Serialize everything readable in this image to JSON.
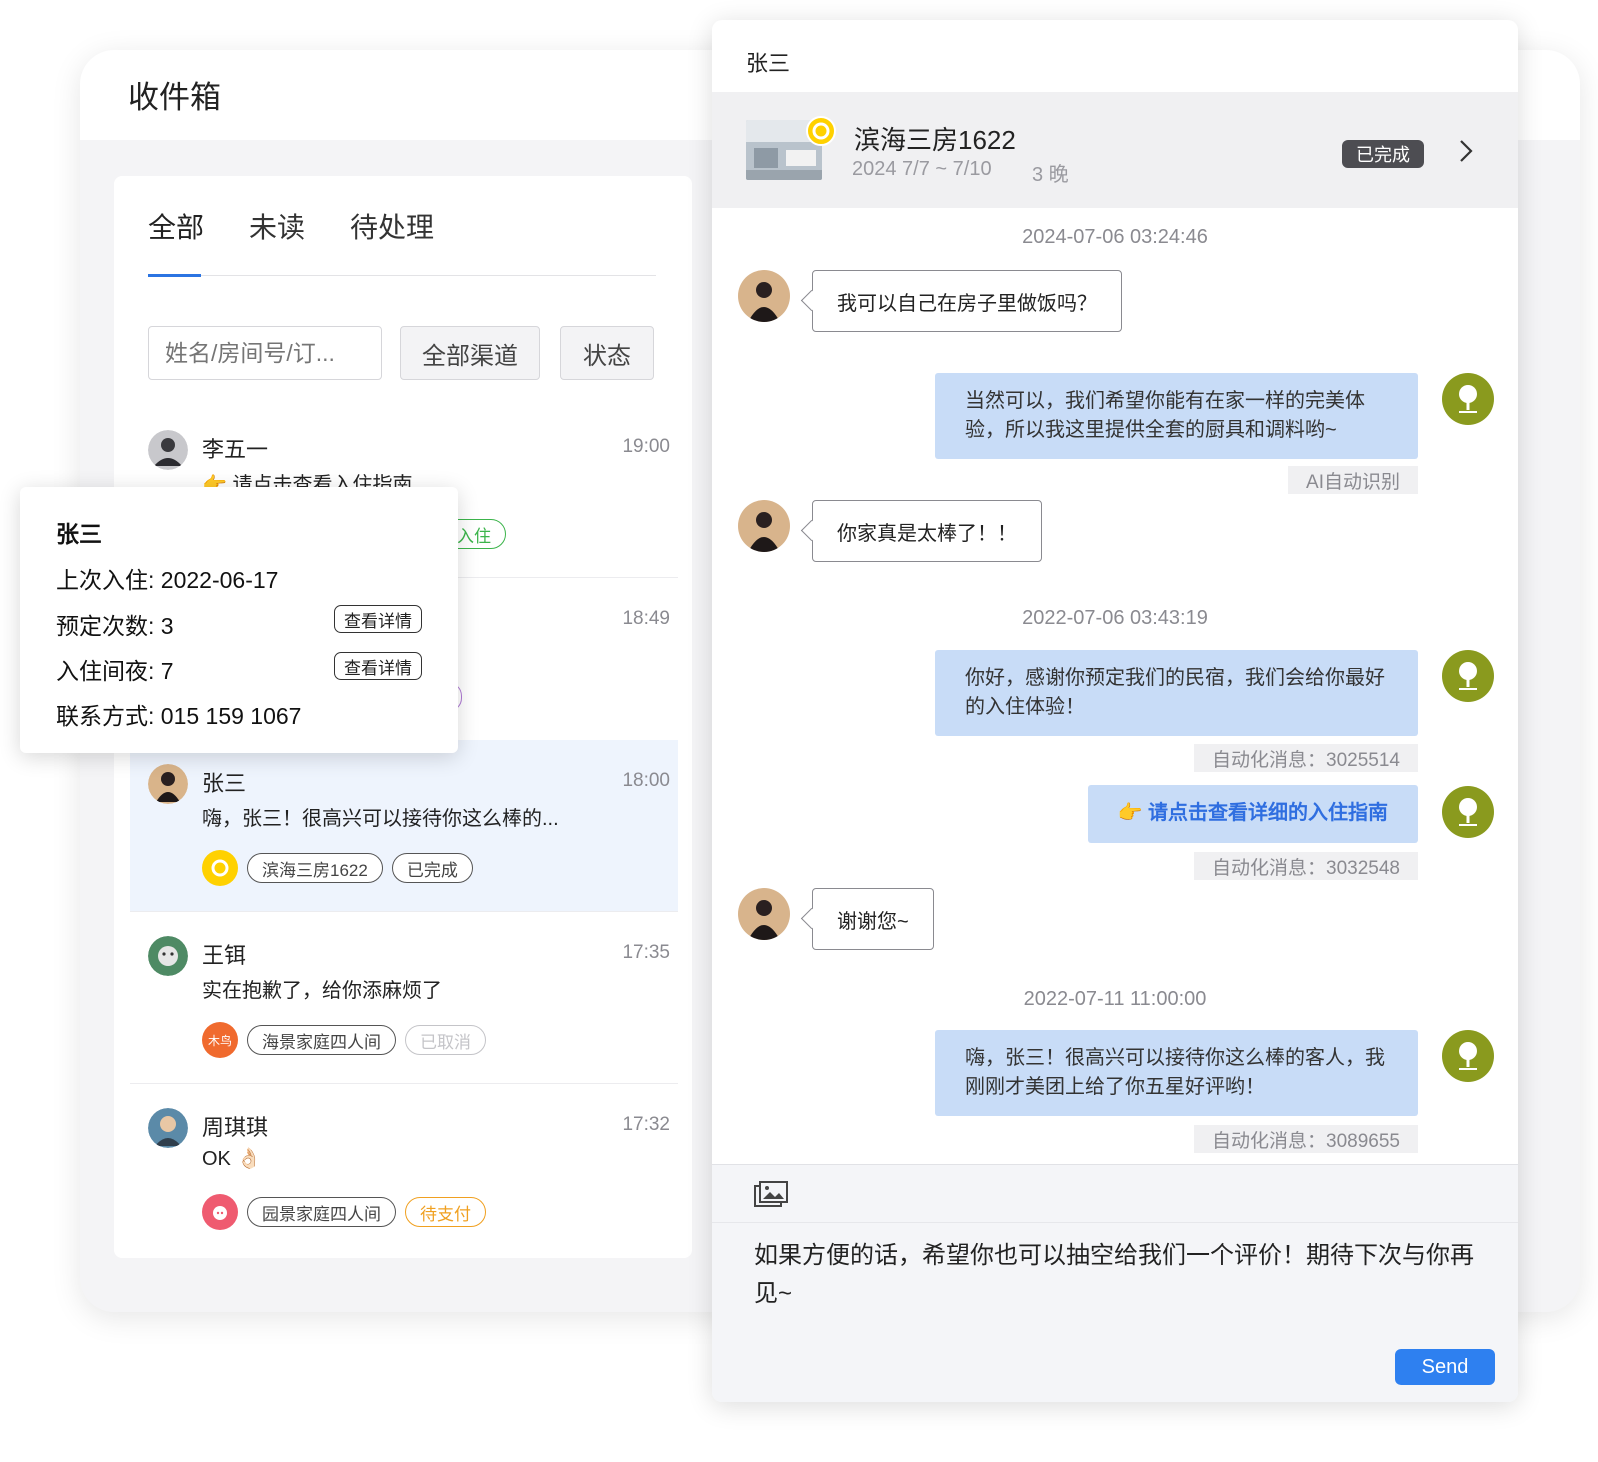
{
  "inbox": {
    "title": "收件箱",
    "tabs": [
      {
        "label": "全部",
        "active": true
      },
      {
        "label": "未读",
        "active": false
      },
      {
        "label": "待处理",
        "active": false
      }
    ],
    "search": {
      "placeholder": "姓名/房间号/订..."
    },
    "filters": {
      "channel": "全部渠道",
      "status": "状态"
    },
    "conversations": [
      {
        "name": "李五一",
        "time": "19:00",
        "preview": "👉 请点击查看入住指南",
        "tags": [
          "入住"
        ]
      },
      {
        "name": "",
        "time": "18:49",
        "preview": "",
        "tags": []
      },
      {
        "name": "张三",
        "time": "18:00",
        "preview": "嗨，张三！很高兴可以接待你这么棒的...",
        "tags": [
          "滨海三房1622",
          "已完成"
        ],
        "channel": "yellow-ring-logo",
        "selected": true
      },
      {
        "name": "王铒",
        "time": "17:35",
        "preview": "实在抱歉了，给你添麻烦了",
        "tags": [
          "海景家庭四人间",
          "已取消"
        ],
        "channel": "木鸟"
      },
      {
        "name": "周琪琪",
        "time": "17:32",
        "preview": "OK 👌🏻",
        "tags": [
          "园景家庭四人间",
          "待支付"
        ],
        "channel": "pink-pig-logo"
      }
    ]
  },
  "guest_popover": {
    "name": "张三",
    "last_stay": "上次入住: 2022-06-17",
    "booking_count": "预定次数: 3",
    "nights": "入住间夜: 7",
    "contact": "联系方式: 015 159 1067",
    "detail_label": "查看详情"
  },
  "chat": {
    "title": "张三",
    "booking": {
      "room": "滨海三房1622",
      "dates": "2024 7/7 ~ 7/10",
      "nights": "3 晚",
      "status": "已完成"
    },
    "timestamps": [
      "2024-07-06 03:24:46",
      "2022-07-06 03:43:19",
      "2022-07-11 11:00:00"
    ],
    "messages": [
      {
        "from": "guest",
        "text": "我可以自己在房子里做饭吗？"
      },
      {
        "from": "host",
        "text": "当然可以，我们希望你能有在家一样的完美体验，所以我这里提供全套的厨具和调料哟~",
        "note": "AI自动识别"
      },
      {
        "from": "guest",
        "text": "你家真是太棒了！！"
      },
      {
        "from": "host",
        "text": "你好，感谢你预定我们的民宿，我们会给你最好的入住体验！",
        "note": "自动化消息：3025514"
      },
      {
        "from": "host",
        "text": "👉 请点击查看详细的入住指南",
        "note": "自动化消息：3032548"
      },
      {
        "from": "guest",
        "text": "谢谢您~"
      },
      {
        "from": "host",
        "text": "嗨，张三！很高兴可以接待你这么棒的客人，我刚刚才美团上给了你五星好评哟！",
        "note": "自动化消息：3089655"
      }
    ],
    "composer": {
      "text": "如果方便的话，希望你也可以抽空给我们一个评价！期待下次与你再见~",
      "send_label": "Send",
      "image_icon": "image-upload-icon"
    }
  },
  "colors": {
    "accent": "#2b74e2",
    "host_bubble": "#c8dcf7",
    "selected_row": "#eef4fd",
    "tag_green": "#3cb44b",
    "tag_purple": "#b07ad6",
    "tag_orange": "#f0a020",
    "tag_disabled": "#c4c4c8",
    "send_button": "#2e80f0"
  }
}
